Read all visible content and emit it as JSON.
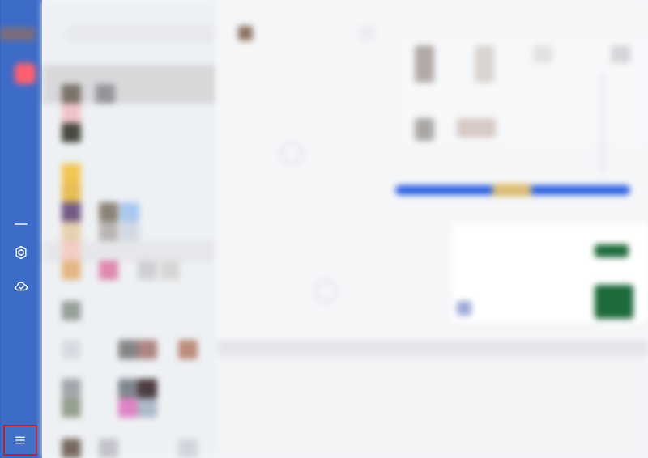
{
  "rail": {
    "icons": [
      "hexagon-icon",
      "cloud-icon",
      "menu-icon"
    ]
  },
  "colors": {
    "rail": "#3c6cc8",
    "badge": "#ff5f6f",
    "menu_highlight": "#c21f2e",
    "slider": "#2b5fe0",
    "slider_highlight": "#e3c06d",
    "green_chip": "#1d6a3a"
  }
}
